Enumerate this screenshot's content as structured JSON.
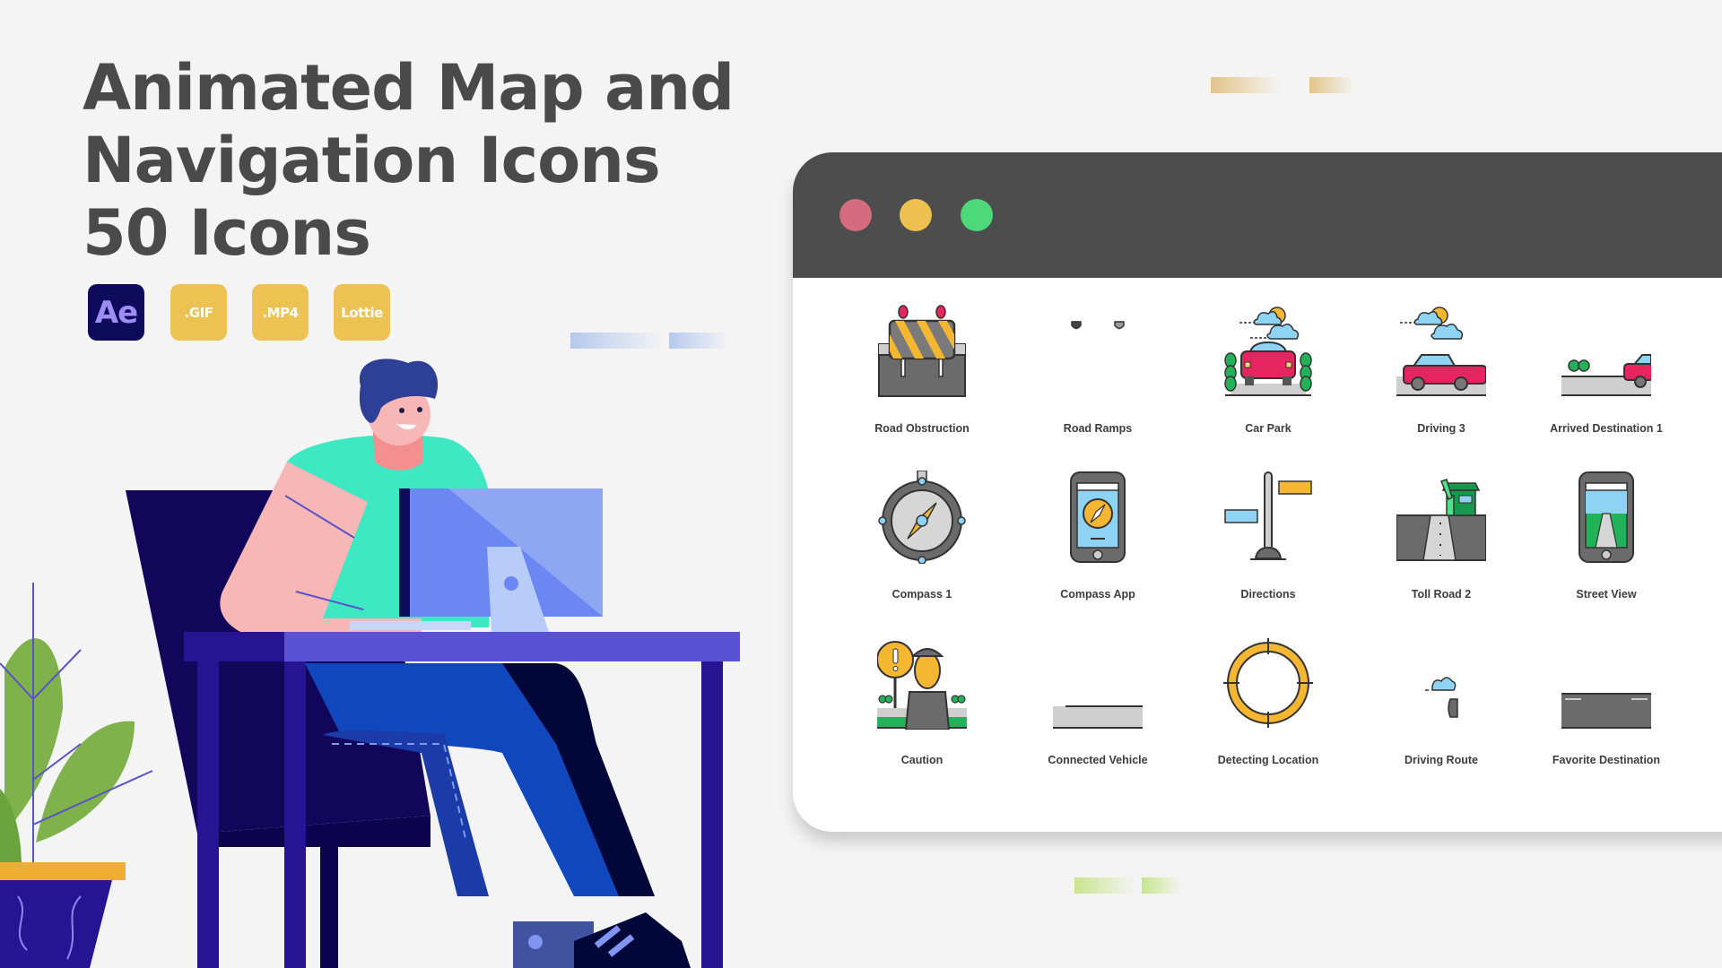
{
  "header": {
    "title_lines": [
      "Animated Map and",
      "Navigation Icons",
      "50 Icons"
    ]
  },
  "badges": [
    {
      "label": "Ae",
      "kind": "after-effects"
    },
    {
      "label": ".GIF",
      "kind": "format"
    },
    {
      "label": ".MP4",
      "kind": "format"
    },
    {
      "label": "Lottie",
      "kind": "format"
    }
  ],
  "colors": {
    "background": "#f4f4f4",
    "title_text": "#4a4a4a",
    "titlebar": "#4d4d4d",
    "dot_close": "#d46b7f",
    "dot_minimize": "#edc04f",
    "dot_maximize": "#4dd87a",
    "badge_yellow": "#ecc252",
    "badge_ae_bg": "#0e0b5c",
    "badge_ae_text": "#9d8df5"
  },
  "window": {
    "controls": [
      "close",
      "minimize",
      "maximize"
    ],
    "icons": [
      {
        "label": "Road Obstruction",
        "icon": "road-obstruction-icon"
      },
      {
        "label": "Road Ramps",
        "icon": "road-ramps-icon"
      },
      {
        "label": "Car Park",
        "icon": "car-park-icon"
      },
      {
        "label": "Driving 3",
        "icon": "driving-icon"
      },
      {
        "label": "Arrived Destination 1",
        "icon": "arrived-destination-icon"
      },
      {
        "label": "Compass 1",
        "icon": "compass-icon"
      },
      {
        "label": "Compass App",
        "icon": "compass-app-icon"
      },
      {
        "label": "Directions",
        "icon": "directions-signpost-icon"
      },
      {
        "label": "Toll Road 2",
        "icon": "toll-road-icon"
      },
      {
        "label": "Street View",
        "icon": "street-view-icon"
      },
      {
        "label": "Caution",
        "icon": "caution-officer-icon"
      },
      {
        "label": "Connected Vehicle",
        "icon": "connected-vehicle-icon"
      },
      {
        "label": "Detecting Location",
        "icon": "detecting-location-icon"
      },
      {
        "label": "Driving Route",
        "icon": "driving-route-icon"
      },
      {
        "label": "Favorite Destination",
        "icon": "favorite-destination-icon"
      }
    ]
  }
}
